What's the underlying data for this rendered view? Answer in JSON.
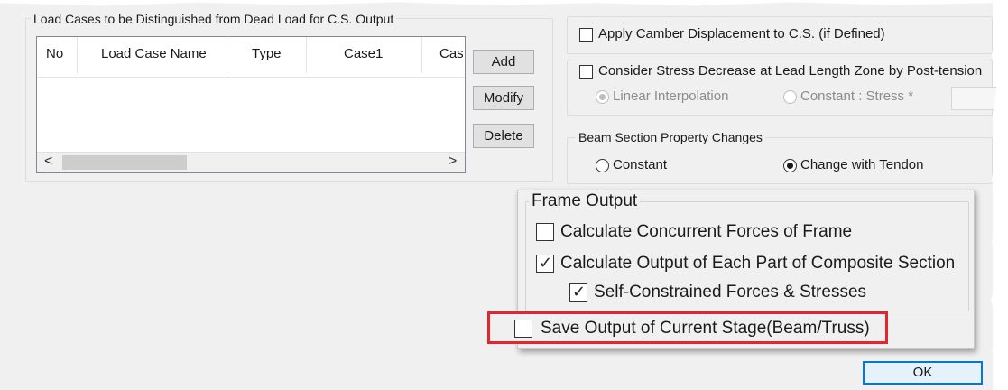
{
  "load_cases_group": {
    "title": "Load Cases to be Distinguished from Dead Load for C.S. Output",
    "columns": [
      "No",
      "Load Case Name",
      "Type",
      "Case1",
      "Cas"
    ],
    "scroll_left": "<",
    "scroll_right": ">"
  },
  "buttons": {
    "add": "Add",
    "modify": "Modify",
    "delete": "Delete",
    "ok": "OK"
  },
  "right_options": {
    "apply_camber": {
      "label": "Apply Camber Displacement to C.S. (if Defined)",
      "checked": false
    },
    "consider_stress": {
      "label": "Consider Stress Decrease at Lead Length Zone by Post-tension",
      "checked": false
    },
    "linear_interpolation": {
      "label": "Linear Interpolation",
      "selected": true,
      "enabled": false
    },
    "constant_stress": {
      "label": "Constant : Stress *",
      "selected": false,
      "enabled": false
    }
  },
  "beam_section_group": {
    "title": "Beam Section Property Changes",
    "constant": {
      "label": "Constant",
      "selected": false
    },
    "change_with_tendon": {
      "label": "Change with Tendon",
      "selected": true
    }
  },
  "frame_output": {
    "title": "Frame Output",
    "concurrent_forces": {
      "label": "Calculate Concurrent Forces of Frame",
      "checked": false
    },
    "composite_output": {
      "label": "Calculate Output of Each Part of Composite Section",
      "checked": true
    },
    "self_constrained": {
      "label": "Self-Constrained Forces & Stresses",
      "checked": true
    }
  },
  "save_output": {
    "label": "Save Output of Current Stage(Beam/Truss)",
    "checked": false
  },
  "colors": {
    "dialog_bg": "#f0f0f0",
    "highlight_border": "#e3262d",
    "ok_border": "#0078d7"
  }
}
